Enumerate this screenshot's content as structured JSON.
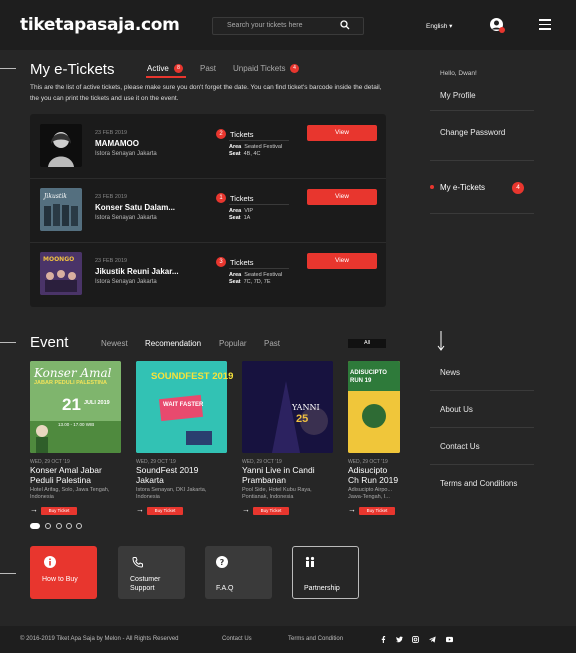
{
  "header": {
    "logo": "tiketapasaja.com",
    "search_placeholder": "Search your tickets here",
    "language": "English ▾"
  },
  "etickets": {
    "title": "My e-Tickets",
    "tabs": [
      {
        "label": "Active",
        "badge": "8"
      },
      {
        "label": "Past"
      },
      {
        "label": "Unpaid Tickets",
        "badge": "4"
      }
    ],
    "intro": "This are the list of active tickets, please make sure you don't forget the date. You can find ticket's barcode inside the detail, the you can print the tickets and use it on the event.",
    "items": [
      {
        "date": "23 FEB 2019",
        "name": "MAMAMOO",
        "venue": "Istora Senayan Jakarta",
        "count": "2",
        "label": "Tickets",
        "area": "Seated Festival",
        "seat": "4B, 4C",
        "button": "View"
      },
      {
        "date": "23 FEB 2019",
        "name": "Konser Satu Dalam...",
        "venue": "Istora Senayan Jakarta",
        "count": "1",
        "label": "Tickets",
        "area": "VIP",
        "seat": "1A",
        "button": "View"
      },
      {
        "date": "23 FEB 2019",
        "name": "Jikustik Reuni Jakar...",
        "venue": "Istora Senayan Jakarta",
        "count": "3",
        "label": "Tickets",
        "area": "Seated Festival",
        "seat": "7C, 7D, 7E",
        "button": "View"
      }
    ],
    "area_label": "Area",
    "seat_label": "Seat"
  },
  "sidebar": {
    "greeting": "Hello, Dwan!",
    "items": [
      "My Profile",
      "Change Password",
      "My e-Tickets"
    ],
    "etickets_badge": "4",
    "links": [
      "News",
      "About Us",
      "Contact Us",
      "Terms and Conditions"
    ]
  },
  "events": {
    "title": "Event",
    "tabs": [
      "Newest",
      "Recomendation",
      "Popular",
      "Past"
    ],
    "all": "All",
    "items": [
      {
        "date": "WED, 29 OCT '19",
        "title": "Konser Amal Jabar Peduli Palestina",
        "venue": "Hotel Arifag, Solo, Jawa Tengah, Indonesia",
        "buy": "Buy Ticket",
        "poster_title": "Konser Amal",
        "poster_sub": "JABAR PEDULI PALESTINA",
        "poster_day": "21",
        "poster_month": "JULI 2019",
        "poster_time": "13.00 - 17.00 WIB"
      },
      {
        "date": "WED, 29 OCT '19",
        "title": "SoundFest 2019 Jakarta",
        "venue": "Istora Senayan, DKI Jakarta, Indonesia",
        "buy": "Buy Ticket",
        "poster_title": "SOUNDFEST 2019",
        "poster_sub": "WAIT FASTER"
      },
      {
        "date": "WED, 29 OCT '19",
        "title": "Yanni Live in Candi Prambanan",
        "venue": "Pool Side, Hotel Kubu Raya, Pontianak, Indonesia",
        "buy": "Buy Ticket",
        "poster_title": "YANNI",
        "poster_sub": "25"
      },
      {
        "date": "WED, 29 OCT '19",
        "title": "Adisucipto Ch Run 2019",
        "venue": "Adisucipto Airpo... Jawa-Tengah, I...",
        "buy": "Buy Ticket",
        "poster_title": "ADISUCIPTO RUN 19"
      }
    ]
  },
  "services": [
    {
      "label": "How to Buy"
    },
    {
      "label": "Costumer Support"
    },
    {
      "label": "F.A.Q"
    },
    {
      "label": "Partnership"
    }
  ],
  "footer": {
    "copyright": "© 2016-2019 Tiket Apa Saja by Melon - All Rights Reserved",
    "links": [
      "Contact Us",
      "Terms and Condition"
    ]
  },
  "colors": {
    "accent": "#e8362e",
    "background": "#262626"
  }
}
